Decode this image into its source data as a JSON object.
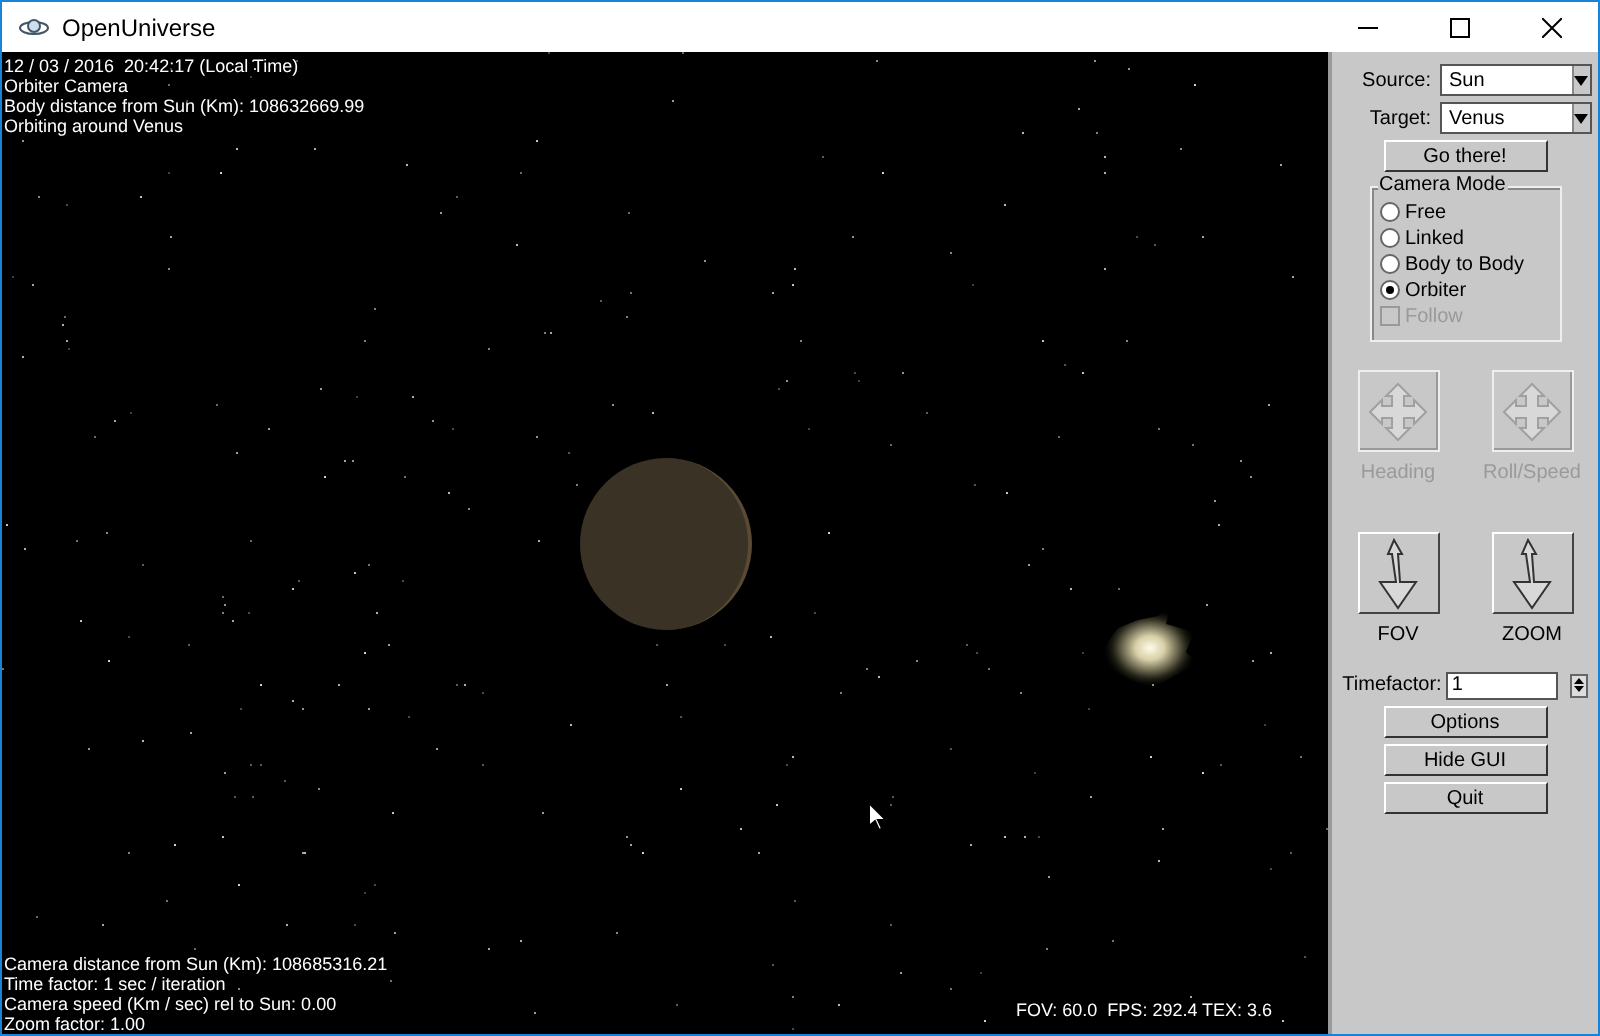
{
  "window": {
    "title": "OpenUniverse"
  },
  "overlay_top": [
    "12 / 03 / 2016  20:42:17 (Local Time)",
    "Orbiter Camera",
    "Body distance from Sun (Km): 108632669.99",
    "Orbiting around Venus"
  ],
  "overlay_bottom": [
    "Camera distance from Sun (Km): 108685316.21",
    "Time factor: 1 sec / iteration",
    "Camera speed (Km / sec) rel to Sun: 0.00",
    "Zoom factor: 1.00"
  ],
  "stats": "FOV: 60.0  FPS: 292.4 TEX: 3.6",
  "panel": {
    "source": {
      "label": "Source:",
      "value": "Sun"
    },
    "target": {
      "label": "Target:",
      "value": "Venus"
    },
    "go_button": "Go there!",
    "camera_mode": {
      "title": "Camera Mode",
      "options": [
        {
          "label": "Free",
          "selected": false
        },
        {
          "label": "Linked",
          "selected": false
        },
        {
          "label": "Body to Body",
          "selected": false
        },
        {
          "label": "Orbiter",
          "selected": true
        }
      ],
      "follow": {
        "label": "Follow",
        "checked": false,
        "disabled": true
      }
    },
    "pads": [
      {
        "label": "Heading",
        "kind": "cross",
        "disabled": true
      },
      {
        "label": "Roll/Speed",
        "kind": "cross",
        "disabled": true
      },
      {
        "label": "FOV",
        "kind": "updown",
        "disabled": false
      },
      {
        "label": "ZOOM",
        "kind": "updown",
        "disabled": false
      }
    ],
    "timefactor": {
      "label": "Timefactor:",
      "value": "1"
    },
    "buttons": [
      "Options",
      "Hide GUI",
      "Quit"
    ]
  }
}
